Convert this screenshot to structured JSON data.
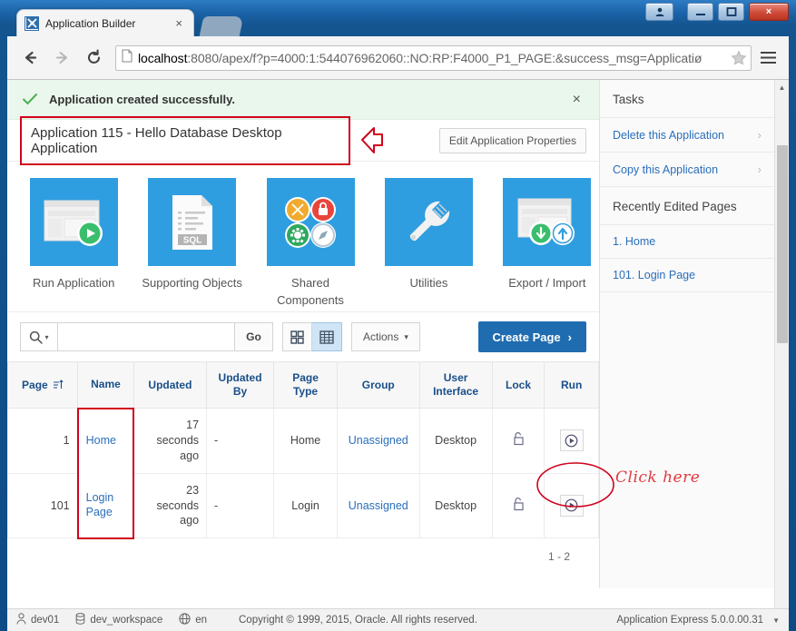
{
  "window": {
    "buttons": [
      {
        "name": "user-account-button",
        "glyph": "person"
      },
      {
        "name": "minimize-button",
        "glyph": "minimize"
      },
      {
        "name": "maximize-button",
        "glyph": "maximize"
      },
      {
        "name": "close-button",
        "glyph": "close",
        "label": "×"
      }
    ]
  },
  "browser": {
    "tab": {
      "title": "Application Builder",
      "close_label": "×",
      "favicon": "apex-logo-icon"
    },
    "nav": {
      "back": "←",
      "forward": "→",
      "reload": "C"
    },
    "url": {
      "host": "localhost",
      "rest": ":8080/apex/f?p=4000:1:544076962060::NO:RP:F4000_P1_PAGE:&success_msg=Applicatiø",
      "full": "localhost:8080/apex/f?p=4000:1:544076962060::NO:RP:F4000_P1_PAGE:&success_msg=Applicati"
    }
  },
  "banner": {
    "message": "Application created successfully.",
    "close_label": "×",
    "check_icon": "check-icon",
    "accent": "#4caf50",
    "background": "#eaf7ed"
  },
  "app_header": {
    "title": "Application 115 - Hello Database Desktop Application",
    "edit_button": "Edit Application Properties",
    "highlight_color": "#d0021b"
  },
  "tiles": [
    {
      "label": "Run Application",
      "icon": "run-application-icon"
    },
    {
      "label": "Supporting Objects",
      "icon": "sql-document-icon"
    },
    {
      "label": "Shared Components",
      "icon": "shared-components-icon"
    },
    {
      "label": "Utilities",
      "icon": "wrench-icon"
    },
    {
      "label": "Export / Import",
      "icon": "export-import-icon"
    }
  ],
  "toolbar": {
    "search_placeholder": "",
    "search_value": "",
    "go_label": "Go",
    "actions_label": "Actions",
    "actions_caret": "∨",
    "create_page_label": "Create Page",
    "create_page_caret": "›",
    "view_icon_label": "icon-view-button",
    "view_report_label": "report-view-button",
    "accent": "#1f6cb0"
  },
  "table": {
    "columns": [
      "Page",
      "Name",
      "Updated",
      "Updated By",
      "Page Type",
      "Group",
      "User Interface",
      "Lock",
      "Run"
    ],
    "sort_column": "Page",
    "rows": [
      {
        "page": "1",
        "name": "Home",
        "updated": "17 seconds ago",
        "updated_by": "-",
        "page_type": "Home",
        "group": "Unassigned",
        "user_interface": "Desktop",
        "lock": "unlocked-padlock-icon",
        "run": "run-page-icon"
      },
      {
        "page": "101",
        "name": "Login Page",
        "updated": "23 seconds ago",
        "updated_by": "-",
        "page_type": "Login",
        "group": "Unassigned",
        "user_interface": "Desktop",
        "lock": "unlocked-padlock-icon",
        "run": "run-page-icon"
      }
    ],
    "pagination": "1 - 2"
  },
  "sidebar": {
    "tasks_heading": "Tasks",
    "tasks": [
      {
        "label": "Delete this Application"
      },
      {
        "label": "Copy this Application"
      }
    ],
    "recent_heading": "Recently Edited Pages",
    "recent": [
      {
        "label": "1. Home"
      },
      {
        "label": "101. Login Page"
      }
    ]
  },
  "footer": {
    "user": "dev01",
    "workspace": "dev_workspace",
    "language": "en",
    "copyright": "Copyright © 1999, 2015, Oracle. All rights reserved.",
    "version": "Application Express 5.0.0.00.31"
  },
  "annotations": {
    "click_here": "Click here",
    "color": "#e0393e"
  }
}
